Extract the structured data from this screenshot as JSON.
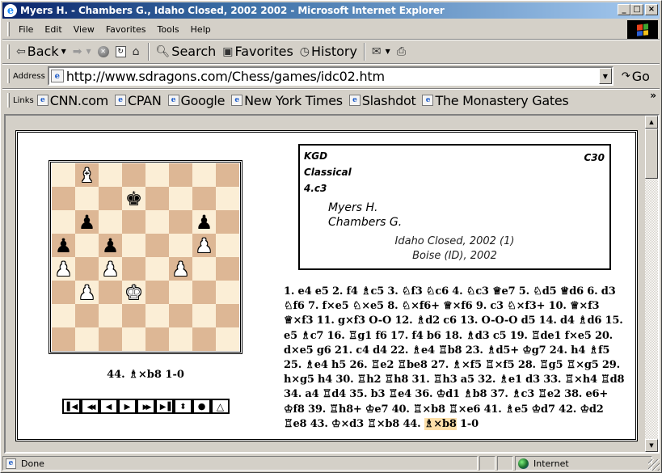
{
  "window": {
    "title": "Myers H. - Chambers G., Idaho Closed, 2002 2002 - Microsoft Internet Explorer",
    "controls": {
      "minimize": "_",
      "maximize": "□",
      "close": "×"
    }
  },
  "menu": [
    "File",
    "Edit",
    "View",
    "Favorites",
    "Tools",
    "Help"
  ],
  "toolbar": {
    "back_label": "Back",
    "search_label": "Search",
    "favorites_label": "Favorites",
    "history_label": "History"
  },
  "address": {
    "label": "Address",
    "url": "http://www.sdragons.com/Chess/games/idc02.htm",
    "go_label": "Go"
  },
  "links": {
    "label": "Links",
    "items": [
      "CNN.com",
      "CPAN",
      "Google",
      "New York Times",
      "Slashdot",
      "The Monastery Gates"
    ],
    "more": "»"
  },
  "board": {
    "orientation": "white-bottom",
    "ranks": [
      [
        "",
        "wB",
        "",
        "",
        "",
        "",
        "",
        ""
      ],
      [
        "",
        "",
        "",
        "bK",
        "",
        "",
        "",
        ""
      ],
      [
        "",
        "bP",
        "",
        "",
        "",
        "",
        "bP",
        ""
      ],
      [
        "bP",
        "",
        "bP",
        "",
        "",
        "",
        "wP",
        ""
      ],
      [
        "wP",
        "",
        "wP",
        "",
        "",
        "wP",
        "",
        ""
      ],
      [
        "",
        "wP",
        "",
        "wK",
        "",
        "",
        "",
        ""
      ],
      [
        "",
        "",
        "",
        "",
        "",
        "",
        "",
        ""
      ],
      [
        "",
        "",
        "",
        "",
        "",
        "",
        "",
        ""
      ]
    ],
    "colors": {
      "light": "#fbeed6",
      "dark": "#ddb795"
    }
  },
  "current_move": "44. ♗×b8 1-0",
  "nav_buttons": [
    {
      "name": "first-move",
      "glyph": "⏮"
    },
    {
      "name": "back-10",
      "glyph": "◀◀"
    },
    {
      "name": "previous-move",
      "glyph": "◀"
    },
    {
      "name": "next-move",
      "glyph": "▶"
    },
    {
      "name": "forward-10",
      "glyph": "▶▶"
    },
    {
      "name": "last-move",
      "glyph": "⏭"
    },
    {
      "name": "flip-board",
      "glyph": "⬍"
    },
    {
      "name": "autoplay",
      "glyph": "●"
    },
    {
      "name": "show-hint",
      "glyph": "△"
    }
  ],
  "game_info": {
    "opening": "KGD",
    "eco": "C30",
    "variation": "Classical",
    "subvariation": "4.c3",
    "white": "Myers H.",
    "black": "Chambers G.",
    "event": "Idaho Closed, 2002 (1)",
    "site": "Boise (ID), 2002"
  },
  "moves": {
    "text": "1. e4 e5 2. f4 ♗c5 3. ♘f3 ♘c6 4. ♘c3 ♕e7 5. ♘d5 ♕d6 6. d3 ♘f6 7. f×e5 ♘×e5 8. ♘×f6+ ♕×f6 9. c3 ♘×f3+ 10. ♕×f3 ♕×f3 11. g×f3 O-O 12. ♗d2 c6 13. O-O-O d5 14. d4 ♗d6 15. e5 ♗c7 16. ♖g1 f6 17. f4 b6 18. ♗d3 c5 19. ♖de1 f×e5 20. d×e5 g6 21. c4 d4 22. ♗e4 ♖b8 23. ♗d5+ ♔g7 24. h4 ♗f5 25. ♗e4 h5 26. ♖e2 ♖be8 27. ♗×f5 ♖×f5 28. ♖g5 ♖×g5 29. h×g5 h4 30. ♖h2 ♖h8 31. ♖h3 a5 32. ♗e1 d3 33. ♖×h4 ♖d8 34. a4 ♖d4 35. b3 ♖e4 36. ♔d1 ♗b8 37. ♗c3 ♖e2 38. e6+ ♔f8 39. ♖h8+ ♔e7 40. ♖×b8 ♖×e6 41. ♗e5 ♔d7 42. ♔d2 ♖e8 43. ♔×d3 ♖×b8 44.",
    "highlighted": "♗×b8",
    "result": "1-0",
    "highlight_color": "#fddfa8"
  },
  "status": {
    "text": "Done",
    "zone": "Internet"
  }
}
